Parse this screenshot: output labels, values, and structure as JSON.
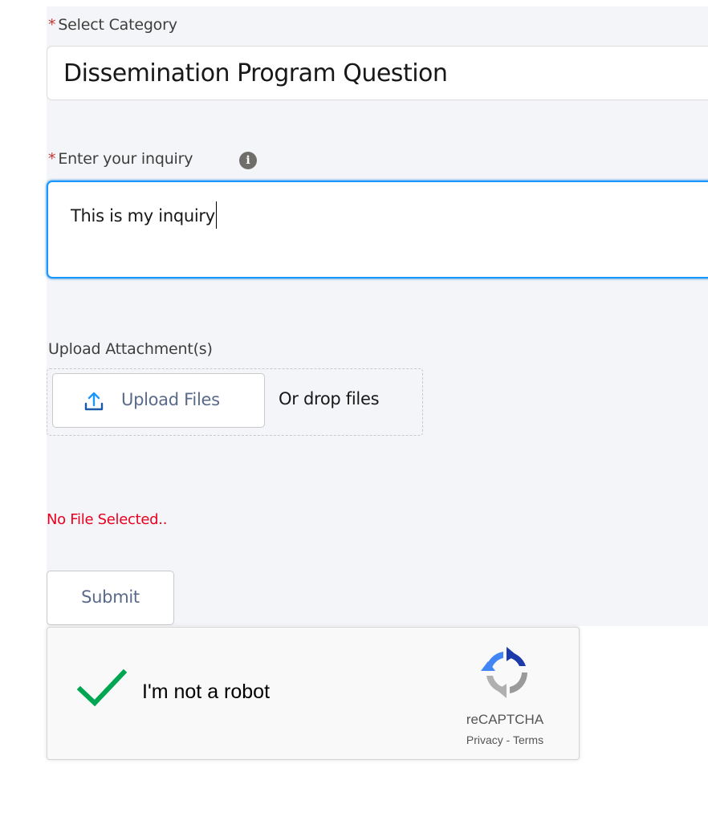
{
  "colors": {
    "required": "#c23934",
    "focus": "#1b96ff",
    "error": "#ea001e",
    "check": "#00a651"
  },
  "category": {
    "required_mark": "*",
    "label": "Select Category",
    "value": "Dissemination Program Question"
  },
  "inquiry": {
    "required_mark": "*",
    "label": "Enter your inquiry",
    "info_icon": "info-icon",
    "value": "This is my inquiry"
  },
  "attachments": {
    "label": "Upload Attachment(s)",
    "upload_button": "Upload Files",
    "upload_icon": "upload-icon",
    "drop_text": "Or drop files",
    "status": "No File Selected.."
  },
  "submit": {
    "label": "Submit"
  },
  "recaptcha": {
    "label": "I'm not a robot",
    "brand": "reCAPTCHA",
    "privacy": "Privacy",
    "separator": " - ",
    "terms": "Terms",
    "checked": true
  }
}
